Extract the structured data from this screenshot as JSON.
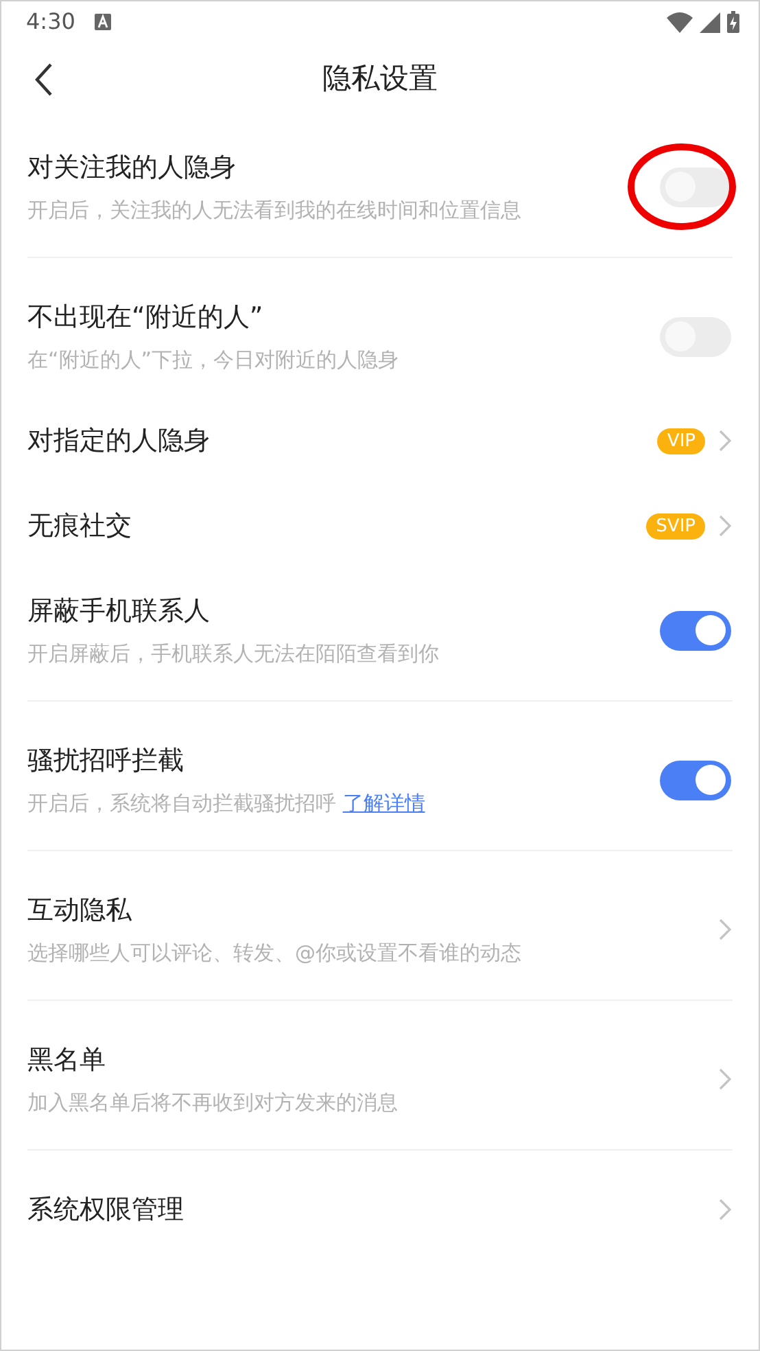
{
  "status_bar": {
    "time": "4:30"
  },
  "header": {
    "title": "隐私设置"
  },
  "groups": [
    [
      {
        "kind": "toggle",
        "title": "对关注我的人隐身",
        "description": "开启后，关注我的人无法看到我的在线时间和位置信息",
        "on": false,
        "circled": true
      }
    ],
    [
      {
        "kind": "toggle",
        "title": "不出现在“附近的人”",
        "description": "在“附近的人”下拉，今日对附近的人隐身",
        "on": false,
        "circled": false
      },
      {
        "kind": "badge",
        "title": "对指定的人隐身",
        "badge": "VIP"
      },
      {
        "kind": "badge",
        "title": "无痕社交",
        "badge": "SVIP"
      },
      {
        "kind": "toggle",
        "title": "屏蔽手机联系人",
        "description": "开启屏蔽后，手机联系人无法在陌陌查看到你",
        "on": true,
        "circled": false
      }
    ],
    [
      {
        "kind": "toggle",
        "title": "骚扰招呼拦截",
        "description": "开启后，系统将自动拦截骚扰招呼",
        "link": "了解详情",
        "on": true,
        "circled": false
      }
    ],
    [
      {
        "kind": "chevron",
        "title": "互动隐私",
        "description": "选择哪些人可以评论、转发、@你或设置不看谁的动态"
      }
    ],
    [
      {
        "kind": "chevron",
        "title": "黑名单",
        "description": "加入黑名单后将不再收到对方发来的消息"
      }
    ],
    [
      {
        "kind": "chevron",
        "title": "系统权限管理"
      }
    ]
  ]
}
